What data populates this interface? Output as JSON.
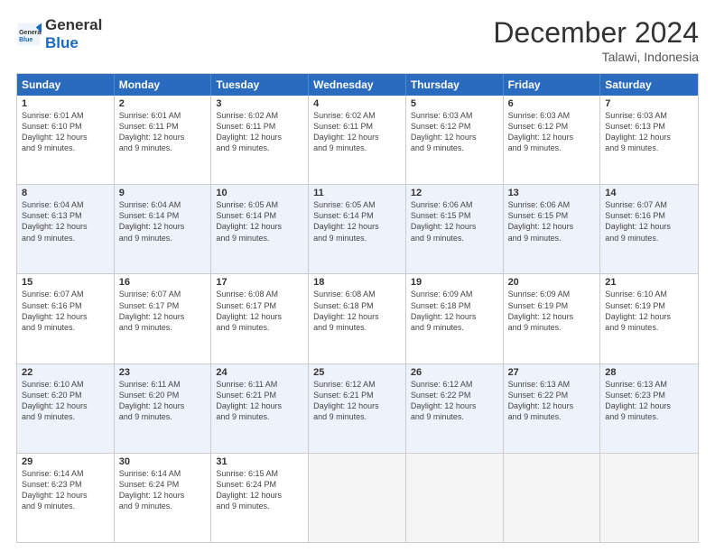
{
  "logo": {
    "line1": "General",
    "line2": "Blue"
  },
  "title": "December 2024",
  "subtitle": "Talawi, Indonesia",
  "days": [
    "Sunday",
    "Monday",
    "Tuesday",
    "Wednesday",
    "Thursday",
    "Friday",
    "Saturday"
  ],
  "rows": [
    [
      {
        "day": 1,
        "sunrise": "6:01 AM",
        "sunset": "6:10 PM",
        "daylight": "12 hours and 9 minutes."
      },
      {
        "day": 2,
        "sunrise": "6:01 AM",
        "sunset": "6:11 PM",
        "daylight": "12 hours and 9 minutes."
      },
      {
        "day": 3,
        "sunrise": "6:02 AM",
        "sunset": "6:11 PM",
        "daylight": "12 hours and 9 minutes."
      },
      {
        "day": 4,
        "sunrise": "6:02 AM",
        "sunset": "6:11 PM",
        "daylight": "12 hours and 9 minutes."
      },
      {
        "day": 5,
        "sunrise": "6:03 AM",
        "sunset": "6:12 PM",
        "daylight": "12 hours and 9 minutes."
      },
      {
        "day": 6,
        "sunrise": "6:03 AM",
        "sunset": "6:12 PM",
        "daylight": "12 hours and 9 minutes."
      },
      {
        "day": 7,
        "sunrise": "6:03 AM",
        "sunset": "6:13 PM",
        "daylight": "12 hours and 9 minutes."
      }
    ],
    [
      {
        "day": 8,
        "sunrise": "6:04 AM",
        "sunset": "6:13 PM",
        "daylight": "12 hours and 9 minutes."
      },
      {
        "day": 9,
        "sunrise": "6:04 AM",
        "sunset": "6:14 PM",
        "daylight": "12 hours and 9 minutes."
      },
      {
        "day": 10,
        "sunrise": "6:05 AM",
        "sunset": "6:14 PM",
        "daylight": "12 hours and 9 minutes."
      },
      {
        "day": 11,
        "sunrise": "6:05 AM",
        "sunset": "6:14 PM",
        "daylight": "12 hours and 9 minutes."
      },
      {
        "day": 12,
        "sunrise": "6:06 AM",
        "sunset": "6:15 PM",
        "daylight": "12 hours and 9 minutes."
      },
      {
        "day": 13,
        "sunrise": "6:06 AM",
        "sunset": "6:15 PM",
        "daylight": "12 hours and 9 minutes."
      },
      {
        "day": 14,
        "sunrise": "6:07 AM",
        "sunset": "6:16 PM",
        "daylight": "12 hours and 9 minutes."
      }
    ],
    [
      {
        "day": 15,
        "sunrise": "6:07 AM",
        "sunset": "6:16 PM",
        "daylight": "12 hours and 9 minutes."
      },
      {
        "day": 16,
        "sunrise": "6:07 AM",
        "sunset": "6:17 PM",
        "daylight": "12 hours and 9 minutes."
      },
      {
        "day": 17,
        "sunrise": "6:08 AM",
        "sunset": "6:17 PM",
        "daylight": "12 hours and 9 minutes."
      },
      {
        "day": 18,
        "sunrise": "6:08 AM",
        "sunset": "6:18 PM",
        "daylight": "12 hours and 9 minutes."
      },
      {
        "day": 19,
        "sunrise": "6:09 AM",
        "sunset": "6:18 PM",
        "daylight": "12 hours and 9 minutes."
      },
      {
        "day": 20,
        "sunrise": "6:09 AM",
        "sunset": "6:19 PM",
        "daylight": "12 hours and 9 minutes."
      },
      {
        "day": 21,
        "sunrise": "6:10 AM",
        "sunset": "6:19 PM",
        "daylight": "12 hours and 9 minutes."
      }
    ],
    [
      {
        "day": 22,
        "sunrise": "6:10 AM",
        "sunset": "6:20 PM",
        "daylight": "12 hours and 9 minutes."
      },
      {
        "day": 23,
        "sunrise": "6:11 AM",
        "sunset": "6:20 PM",
        "daylight": "12 hours and 9 minutes."
      },
      {
        "day": 24,
        "sunrise": "6:11 AM",
        "sunset": "6:21 PM",
        "daylight": "12 hours and 9 minutes."
      },
      {
        "day": 25,
        "sunrise": "6:12 AM",
        "sunset": "6:21 PM",
        "daylight": "12 hours and 9 minutes."
      },
      {
        "day": 26,
        "sunrise": "6:12 AM",
        "sunset": "6:22 PM",
        "daylight": "12 hours and 9 minutes."
      },
      {
        "day": 27,
        "sunrise": "6:13 AM",
        "sunset": "6:22 PM",
        "daylight": "12 hours and 9 minutes."
      },
      {
        "day": 28,
        "sunrise": "6:13 AM",
        "sunset": "6:23 PM",
        "daylight": "12 hours and 9 minutes."
      }
    ],
    [
      {
        "day": 29,
        "sunrise": "6:14 AM",
        "sunset": "6:23 PM",
        "daylight": "12 hours and 9 minutes."
      },
      {
        "day": 30,
        "sunrise": "6:14 AM",
        "sunset": "6:24 PM",
        "daylight": "12 hours and 9 minutes."
      },
      {
        "day": 31,
        "sunrise": "6:15 AM",
        "sunset": "6:24 PM",
        "daylight": "12 hours and 9 minutes."
      },
      null,
      null,
      null,
      null
    ]
  ],
  "alt_rows": [
    1,
    3
  ]
}
